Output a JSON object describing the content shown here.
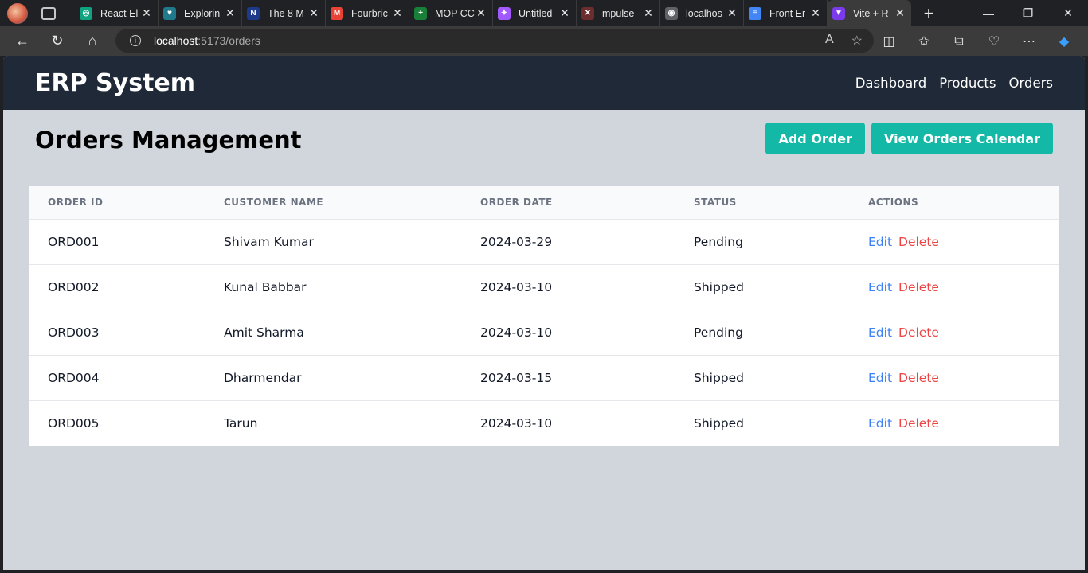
{
  "browser": {
    "tabs": [
      {
        "title": "React El",
        "fav_color": "#10a37f",
        "fav_glyph": "◎"
      },
      {
        "title": "Explorin",
        "fav_color": "#1f7a8c",
        "fav_glyph": "♥"
      },
      {
        "title": "The 8 M",
        "fav_color": "#1e3a8a",
        "fav_glyph": "N"
      },
      {
        "title": "Fourbric",
        "fav_color": "#ea4335",
        "fav_glyph": "M"
      },
      {
        "title": "MOP CC",
        "fav_color": "#188038",
        "fav_glyph": "+"
      },
      {
        "title": "Untitled",
        "fav_color": "#a259ff",
        "fav_glyph": "✦"
      },
      {
        "title": "mpulse",
        "fav_color": "#6b2d2d",
        "fav_glyph": "✕"
      },
      {
        "title": "localhos",
        "fav_color": "#5f6368",
        "fav_glyph": "◉"
      },
      {
        "title": "Front Er",
        "fav_color": "#4285f4",
        "fav_glyph": "≡"
      },
      {
        "title": "Vite + R",
        "fav_color": "#7c3aed",
        "fav_glyph": "▼"
      }
    ],
    "url_host": "localhost",
    "url_rest": ":5173/orders"
  },
  "app": {
    "brand": "ERP System",
    "nav": [
      "Dashboard",
      "Products",
      "Orders"
    ]
  },
  "page": {
    "title": "Orders Management",
    "add_order": "Add Order",
    "view_calendar": "View Orders Calendar"
  },
  "table": {
    "headers": [
      "ORDER ID",
      "CUSTOMER NAME",
      "ORDER DATE",
      "STATUS",
      "ACTIONS"
    ],
    "edit_label": "Edit",
    "delete_label": "Delete",
    "rows": [
      {
        "id": "ORD001",
        "customer": "Shivam Kumar",
        "date": "2024-03-29",
        "status": "Pending"
      },
      {
        "id": "ORD002",
        "customer": "Kunal Babbar",
        "date": "2024-03-10",
        "status": "Shipped"
      },
      {
        "id": "ORD003",
        "customer": "Amit Sharma",
        "date": "2024-03-10",
        "status": "Pending"
      },
      {
        "id": "ORD004",
        "customer": "Dharmendar",
        "date": "2024-03-15",
        "status": "Shipped"
      },
      {
        "id": "ORD005",
        "customer": "Tarun",
        "date": "2024-03-10",
        "status": "Shipped"
      }
    ]
  }
}
